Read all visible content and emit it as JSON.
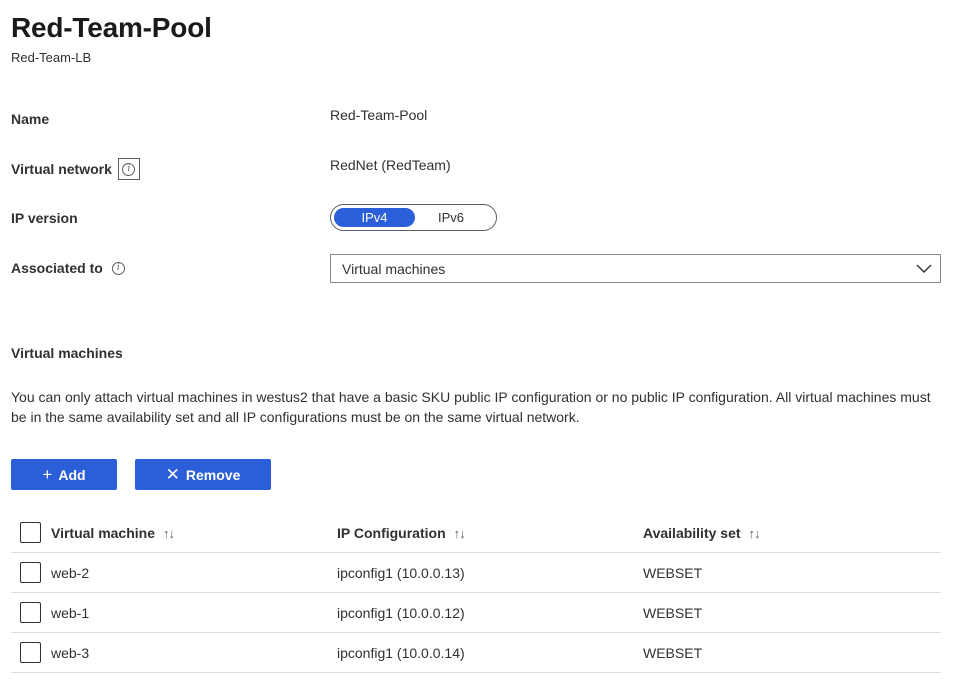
{
  "header": {
    "title": "Red-Team-Pool",
    "subtitle": "Red-Team-LB"
  },
  "fields": {
    "name_label": "Name",
    "name_value": "Red-Team-Pool",
    "vnet_label": "Virtual network",
    "vnet_value": "RedNet (RedTeam)",
    "ipversion_label": "IP version",
    "ipversion_options": [
      "IPv4",
      "IPv6"
    ],
    "ipversion_selected": "IPv4",
    "associated_label": "Associated to",
    "associated_value": "Virtual machines"
  },
  "vm_section": {
    "title": "Virtual machines",
    "description": "You can only attach virtual machines in westus2 that have a basic SKU public IP configuration or no public IP configuration. All virtual machines must be in the same availability set and all IP configurations must be on the same virtual network."
  },
  "toolbar": {
    "add_label": "Add",
    "remove_label": "Remove"
  },
  "icons": {
    "info": "info-icon",
    "chevron": "chevron-down-icon",
    "add": "plus-icon",
    "remove": "close-icon",
    "sort": "sort-icon"
  },
  "colors": {
    "accent": "#2b5fd9",
    "border": "#e1dfdd"
  },
  "table": {
    "columns": [
      "Virtual machine",
      "IP Configuration",
      "Availability set"
    ],
    "sort_glyph": "↑↓",
    "rows": [
      {
        "vm": "web-2",
        "ip": "ipconfig1 (10.0.0.13)",
        "set": "WEBSET"
      },
      {
        "vm": "web-1",
        "ip": "ipconfig1 (10.0.0.12)",
        "set": "WEBSET"
      },
      {
        "vm": "web-3",
        "ip": "ipconfig1 (10.0.0.14)",
        "set": "WEBSET"
      }
    ]
  }
}
